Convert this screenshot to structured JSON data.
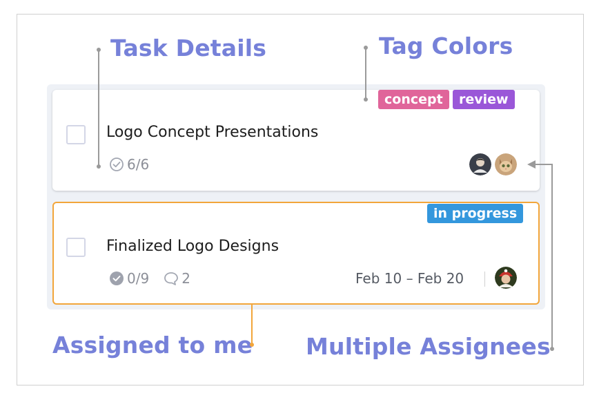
{
  "callouts": {
    "task_details": "Task Details",
    "tag_colors": "Tag Colors",
    "assigned_to_me": "Assigned to me",
    "multiple_assignees": "Multiple Assignees"
  },
  "tasks": [
    {
      "title": "Logo Concept Presentations",
      "tags": [
        {
          "label": "concept",
          "color": "#e0659a"
        },
        {
          "label": "review",
          "color": "#9a57d8"
        }
      ],
      "subtasks": "6/6",
      "assignee_icons": [
        "avatar-person-icon",
        "avatar-cat-icon"
      ]
    },
    {
      "title": "Finalized Logo Designs",
      "tags": [
        {
          "label": "in progress",
          "color": "#3397dd"
        }
      ],
      "subtasks": "0/9",
      "comments": "2",
      "dates": "Feb 10 – Feb 20",
      "assigned_to_me": true,
      "assignee_icons": [
        "avatar-person-icon"
      ]
    }
  ],
  "colors": {
    "callout": "#7681d9",
    "assigned_border": "#f2a53a"
  }
}
